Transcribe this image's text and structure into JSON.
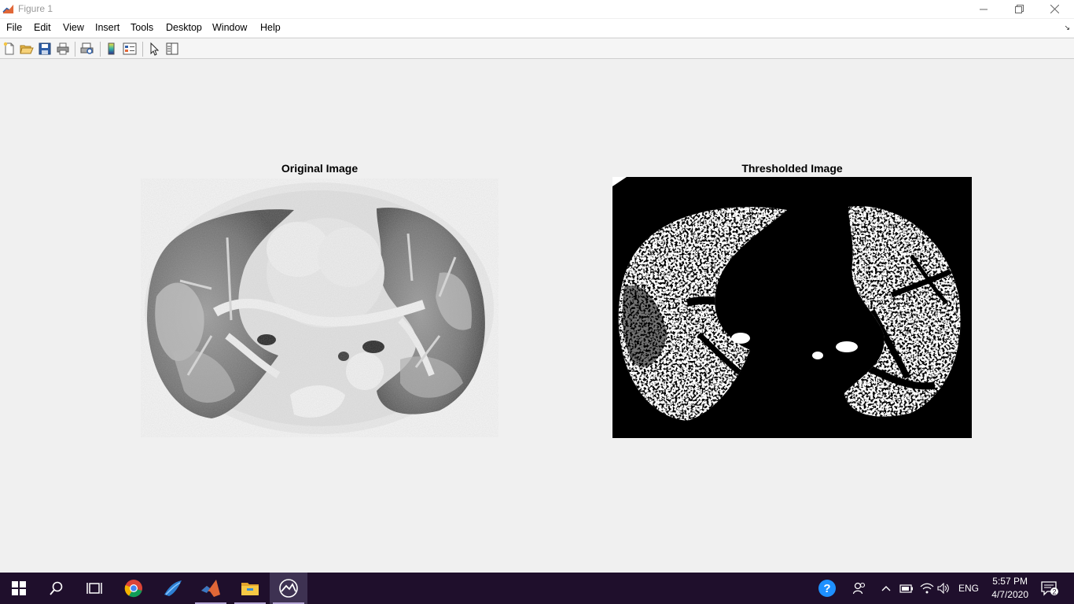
{
  "window": {
    "title": "Figure 1"
  },
  "menu": [
    "File",
    "Edit",
    "View",
    "Insert",
    "Tools",
    "Desktop",
    "Window",
    "Help"
  ],
  "toolbar": {
    "icons": [
      "new-figure-icon",
      "open-file-icon",
      "save-icon",
      "print-icon",
      "print-preview-icon",
      "colorbar-icon",
      "legend-icon",
      "edit-plot-arrow-icon",
      "property-inspector-icon"
    ]
  },
  "figure": {
    "axes": [
      {
        "title": "Original Image",
        "content": "grayscale chest CT scan"
      },
      {
        "title": "Thresholded Image",
        "content": "binary thresholded chest CT scan"
      }
    ]
  },
  "taskbar": {
    "apps": [
      "start-icon",
      "search-icon",
      "task-view-icon",
      "chrome-icon",
      "matlab-shortcut-icon",
      "matlab-icon",
      "file-explorer-icon",
      "figure-window-icon"
    ],
    "language": "ENG",
    "time": "5:57 PM",
    "date": "4/7/2020",
    "notifications": "2"
  },
  "colors": {
    "taskbar": "#1f0f2c",
    "figure_bg": "#f0f0f0",
    "matlab_orange": "#e16737",
    "help_blue": "#1e90ff"
  }
}
